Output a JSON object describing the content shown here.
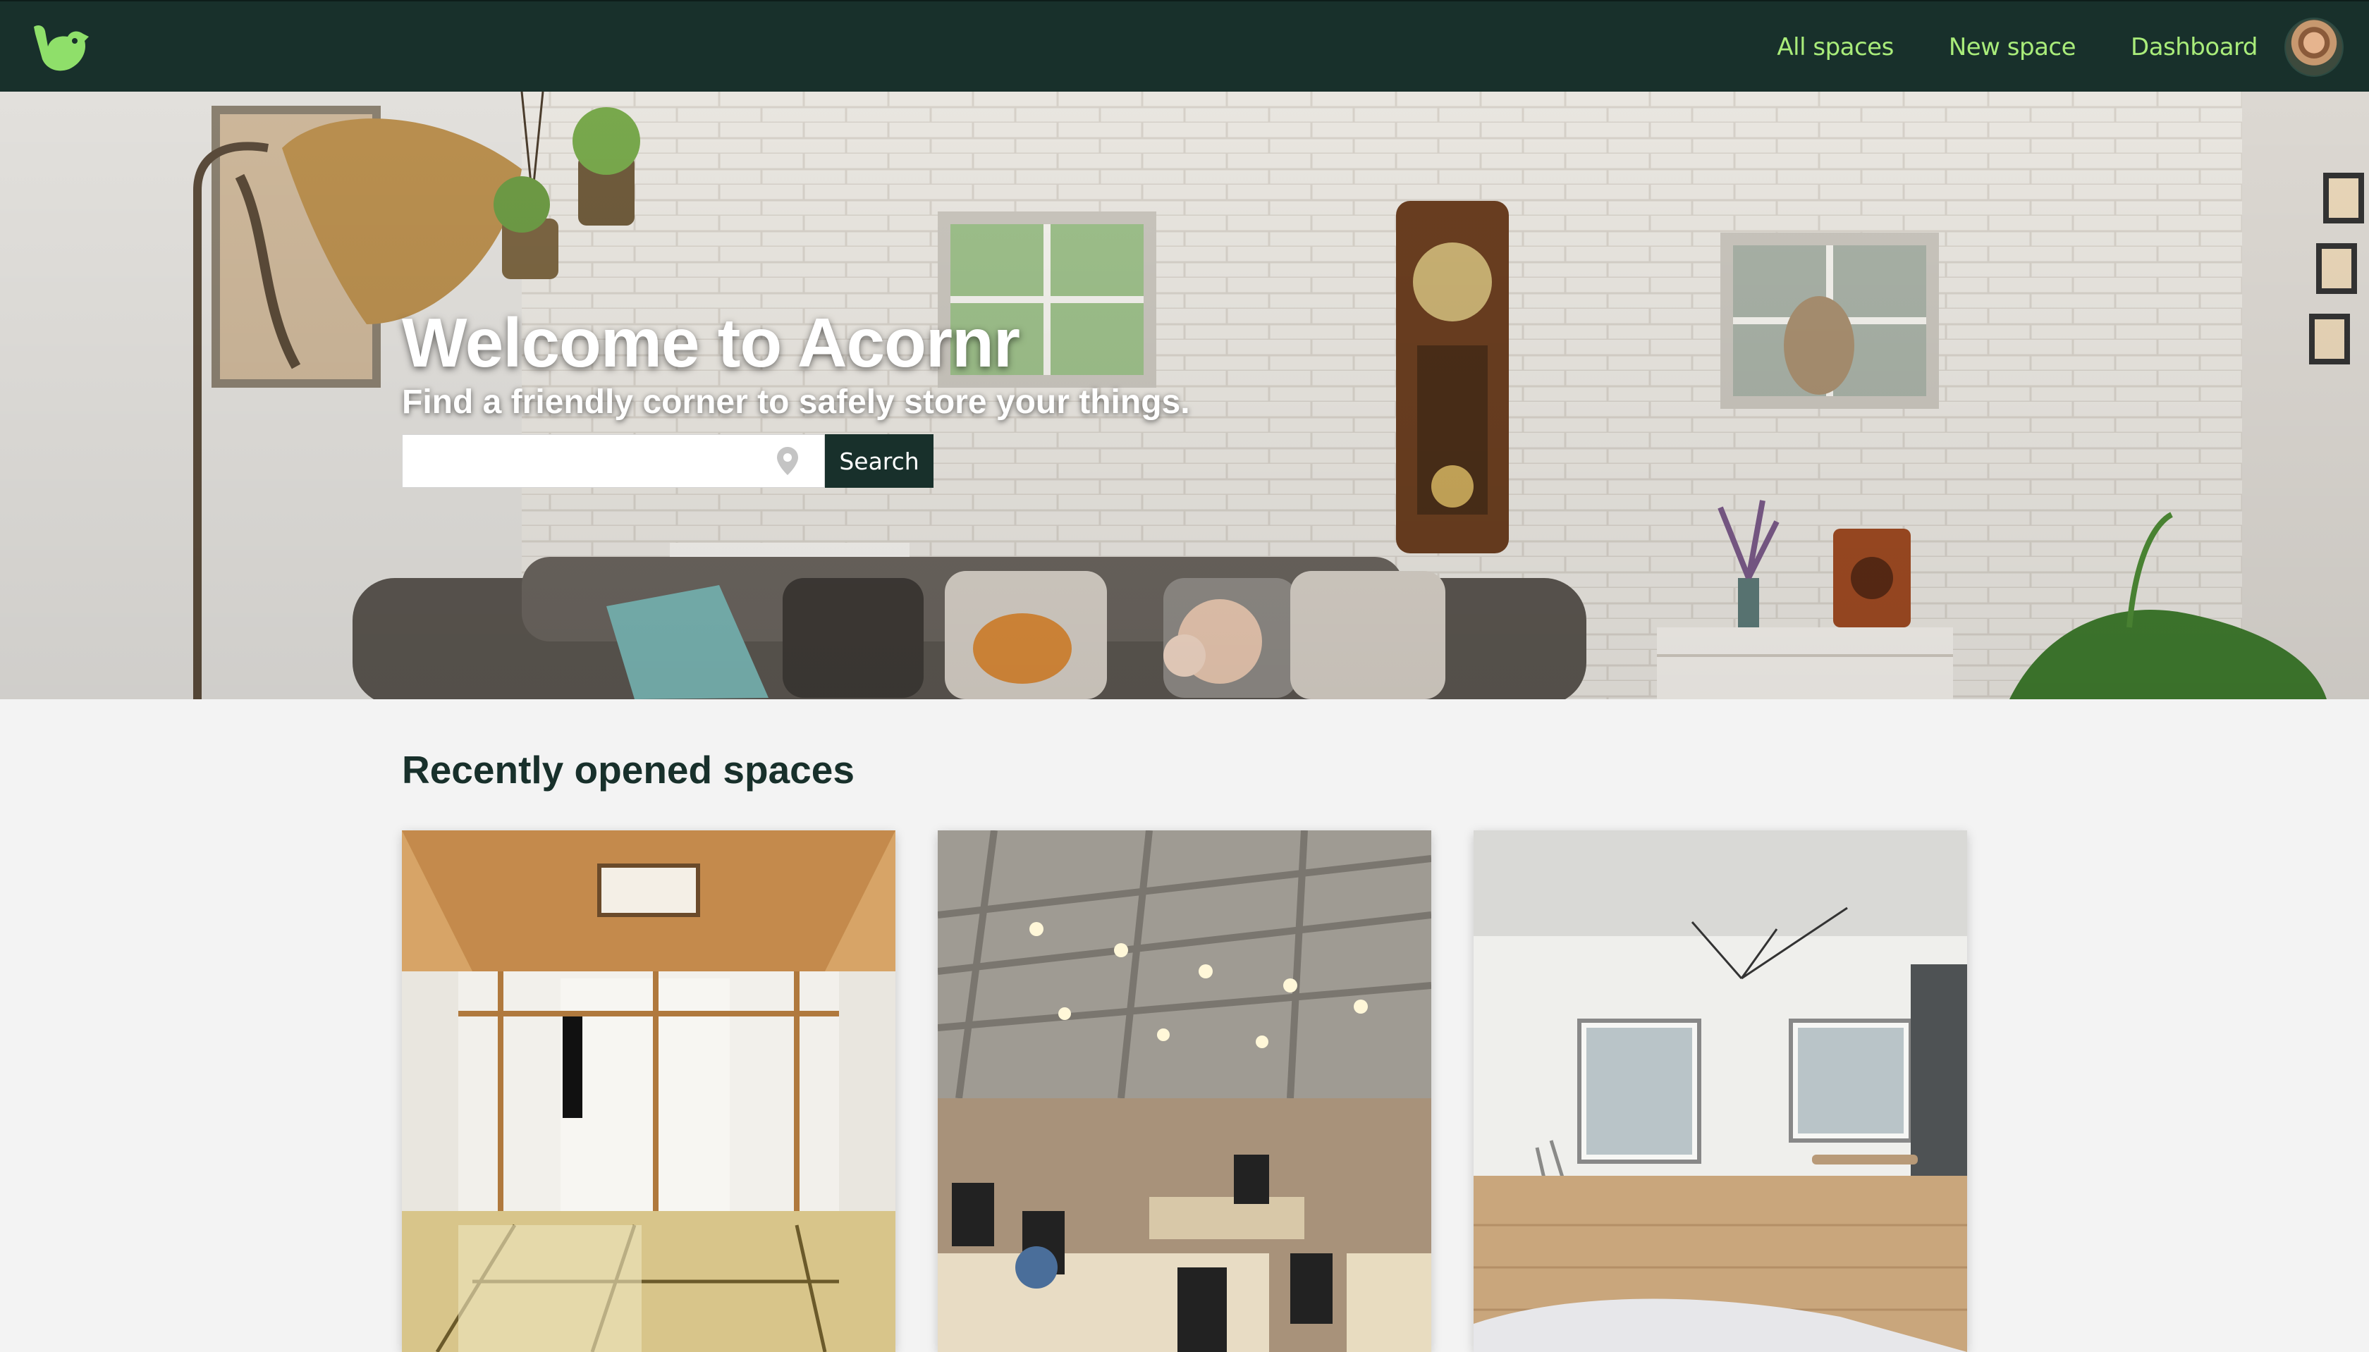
{
  "navbar": {
    "logo": "acornr-bird-logo",
    "links": [
      {
        "label": "All spaces"
      },
      {
        "label": "New space"
      },
      {
        "label": "Dashboard"
      }
    ],
    "avatar": "user-avatar"
  },
  "hero": {
    "title": "Welcome to Acornr",
    "subtitle": "Find a friendly corner to safely store your things.",
    "search": {
      "value": "",
      "placeholder": "",
      "button_label": "Search",
      "icon": "location-pin-icon"
    }
  },
  "recent": {
    "heading": "Recently opened spaces",
    "spaces": [
      {
        "image": "japanese-tatami-room"
      },
      {
        "image": "open-plan-office"
      },
      {
        "image": "empty-loft-room"
      }
    ]
  },
  "colors": {
    "navbar_bg": "#18302b",
    "nav_link": "#a9ec7a",
    "logo": "#8fdf6a",
    "page_bg": "#f3f3f3",
    "heading": "#18302b"
  }
}
